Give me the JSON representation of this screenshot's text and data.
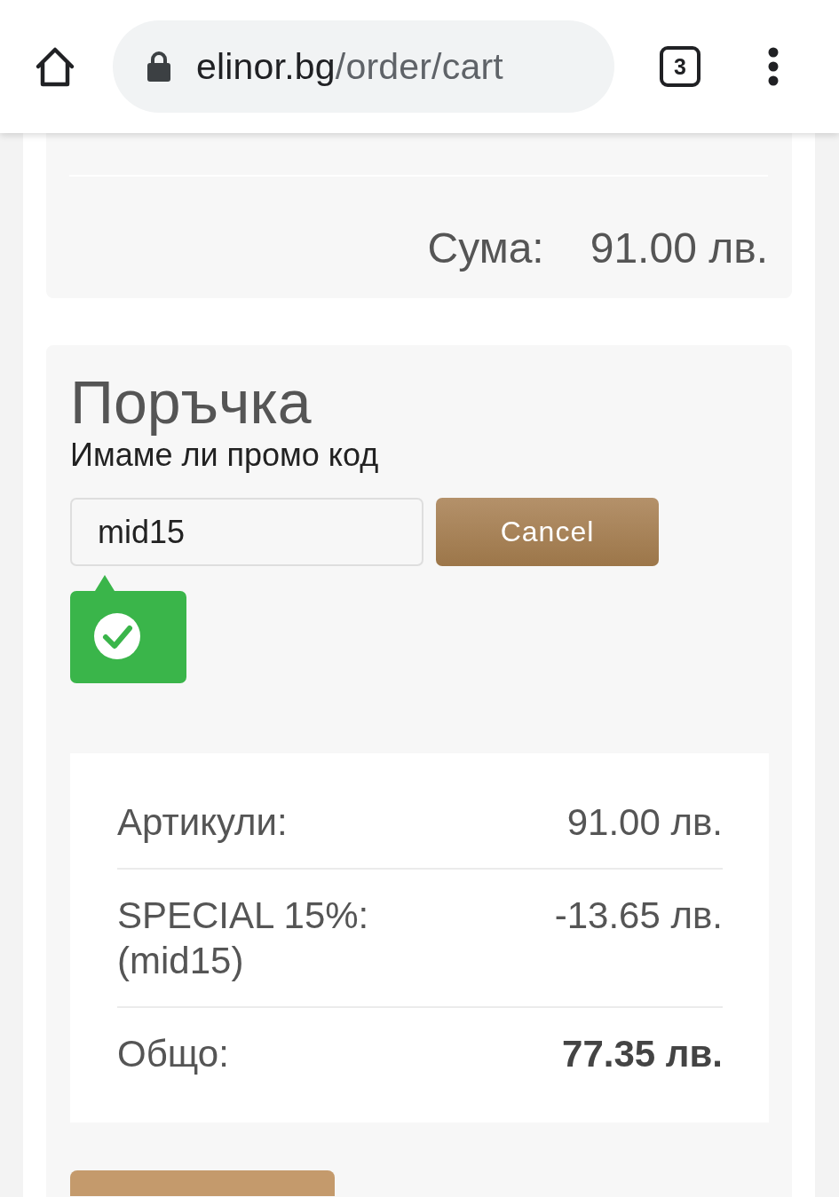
{
  "browser": {
    "url": {
      "host": "elinor.bg",
      "path": "/order/cart"
    },
    "tab_count": "3"
  },
  "cart_summary": {
    "label": "Сума:",
    "amount": "91.00 лв."
  },
  "order": {
    "title": "Поръчка",
    "promo_prompt": "Имаме ли промо код",
    "promo_code": {
      "value": "mid15",
      "valid": true
    },
    "cancel_button": "Cancel",
    "totals": [
      {
        "kind": "line",
        "label": "Артикули:",
        "amount": "91.00 лв."
      },
      {
        "kind": "line",
        "label": "SPECIAL 15%: (mid15)",
        "amount": "-13.65 лв."
      },
      {
        "kind": "total",
        "label": "Общо:",
        "amount": "77.35 лв."
      }
    ]
  }
}
